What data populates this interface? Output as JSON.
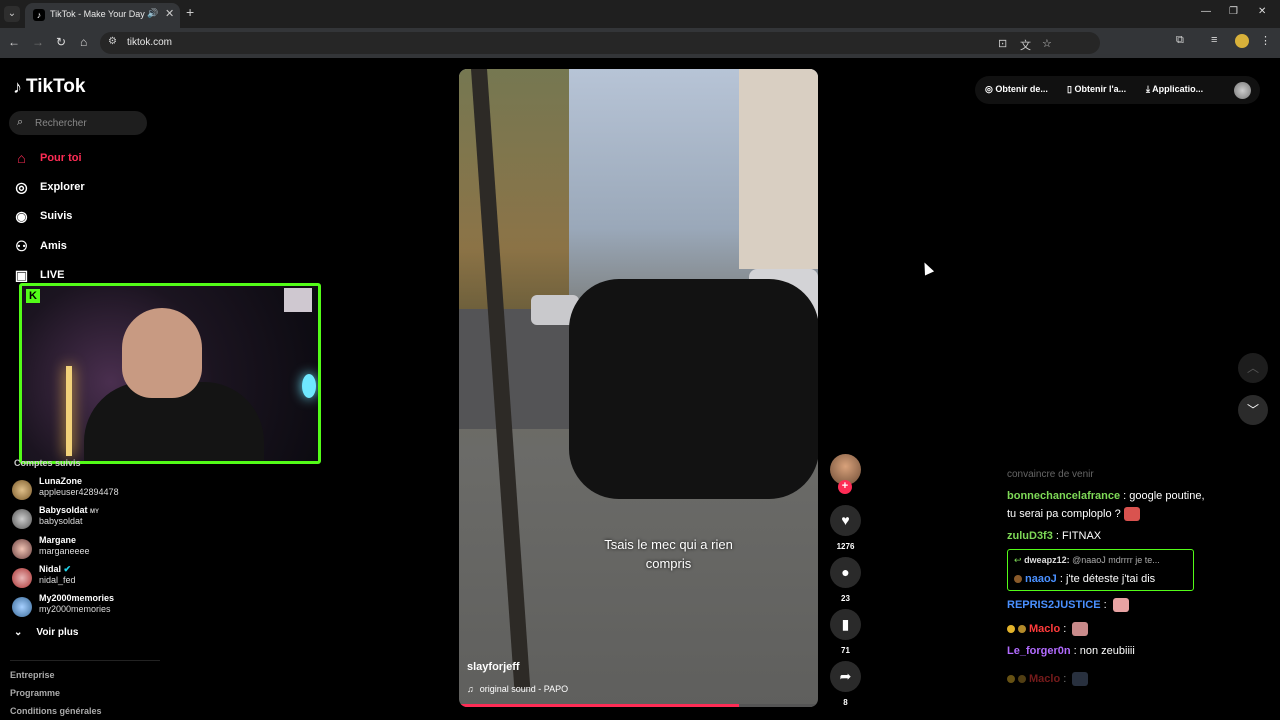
{
  "browser": {
    "tab_title": "TikTok - Make Your Day",
    "url": "tiktok.com"
  },
  "tiktok": {
    "logo_text": "TikTok",
    "search_placeholder": "Rechercher",
    "nav": [
      {
        "label": "Pour toi",
        "icon": "home-icon"
      },
      {
        "label": "Explorer",
        "icon": "compass-icon"
      },
      {
        "label": "Suivis",
        "icon": "following-icon"
      },
      {
        "label": "Amis",
        "icon": "friends-icon"
      },
      {
        "label": "LIVE",
        "icon": "live-icon"
      }
    ],
    "followed_section": "Comptes suivis",
    "followed": [
      {
        "name": "LunaZone",
        "username": "appleuser42894478"
      },
      {
        "name": "Babysoldat",
        "username": "babysoldat",
        "tag": "MY"
      },
      {
        "name": "Margane",
        "username": "marganeeee"
      },
      {
        "name": "Nidal",
        "username": "nidal_fed",
        "verified": true
      },
      {
        "name": "My2000memories",
        "username": "my2000memories"
      }
    ],
    "see_more": "Voir plus",
    "footer": [
      "Entreprise",
      "Programme",
      "Conditions générales"
    ],
    "top_actions": [
      "Obtenir de...",
      "Obtenir l'a...",
      "Applicatio..."
    ],
    "video": {
      "caption_line1": "Tsais le mec qui a rien",
      "caption_line2": "compris",
      "author": "slayforjeff",
      "sound": "original sound - PAPO",
      "progress": 0.78
    },
    "actions": {
      "likes": "1276",
      "comments": "23",
      "saves": "71",
      "shares": "8"
    }
  },
  "chat": {
    "faded": "convaincre de venir",
    "messages": [
      {
        "user": "bonnechancelafrance",
        "user_color": "#7ed957",
        "text": "google poutine,",
        "text2": "tu serai pa comploplo ?"
      },
      {
        "user": "zuluD3f3",
        "user_color": "#7ed957",
        "text": "FITNAX"
      },
      {
        "reply_to": "dweapz12:",
        "reply_text": "@naaoJ mdrrrr je te...",
        "user": "naaoJ",
        "user_color": "#4a90ff",
        "text": "j'te déteste j'tai dis"
      },
      {
        "user": "REPRIS2JUSTICE",
        "user_color": "#4a90ff",
        "text": ""
      },
      {
        "user": "Maclo",
        "user_color": "#ff3b3b",
        "text": ""
      },
      {
        "user": "Le_forger0n",
        "user_color": "#b26bff",
        "text": "non zeubiiii"
      },
      {
        "user": "Maclo",
        "user_color": "#ff3b3b",
        "text": ""
      }
    ]
  }
}
